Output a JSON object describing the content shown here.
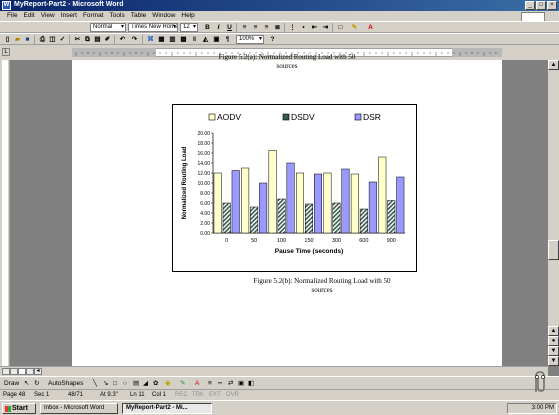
{
  "window": {
    "title": "MyReport-Part2 - Microsoft Word",
    "app_icon": "W"
  },
  "menu": [
    "File",
    "Edit",
    "View",
    "Insert",
    "Format",
    "Tools",
    "Table",
    "Window",
    "Help"
  ],
  "formatting": {
    "style": "Normal",
    "font": "Times New Roman",
    "size": "12"
  },
  "standard": {
    "zoom": "100%"
  },
  "document": {
    "caption_top_line1": "Figure 5.2(a): Normalized Routing Load with 50",
    "caption_top_line2": "sources",
    "caption_bottom_line1": "Figure 5.2(b):  Normalized Routing Load with 50",
    "caption_bottom_line2": "sources"
  },
  "chart_data": {
    "type": "bar",
    "categories": [
      "0",
      "50",
      "100",
      "150",
      "300",
      "600",
      "900"
    ],
    "series": [
      {
        "name": "AODV",
        "values": [
          12.0,
          13.0,
          16.5,
          12.0,
          12.0,
          11.8,
          15.2
        ],
        "color": "#ffffcc"
      },
      {
        "name": "DSDV",
        "values": [
          6.0,
          5.2,
          6.8,
          5.8,
          6.0,
          4.8,
          6.5
        ],
        "color": "#3a5a50"
      },
      {
        "name": "DSR",
        "values": [
          12.5,
          10.0,
          14.0,
          11.8,
          12.8,
          10.2,
          11.2
        ],
        "color": "#9999ff"
      }
    ],
    "ylim": [
      0,
      20
    ],
    "yticks": [
      "0.00",
      "2.00",
      "4.00",
      "6.00",
      "8.00",
      "10.00",
      "12.00",
      "14.00",
      "16.00",
      "18.00",
      "20.00"
    ],
    "xlabel": "Pause Time (seconds)",
    "ylabel": "Normalized Routing Load",
    "legend_position": "top"
  },
  "drawing_toolbar": {
    "draw": "Draw",
    "autoshapes": "AutoShapes"
  },
  "status": {
    "page": "Page 48",
    "sec": "Sec 1",
    "pages": "48/71",
    "at": "At 9.3\"",
    "ln": "Ln 11",
    "col": "Col 1",
    "rec": "REC",
    "trk": "TRK",
    "ext": "EXT",
    "ovr": "OVR"
  },
  "taskbar": {
    "start": "Start",
    "tasks": [
      "Inbox - Microsoft Word",
      "MyReport-Part2 - Mi..."
    ],
    "clock": "3:00 PM"
  }
}
